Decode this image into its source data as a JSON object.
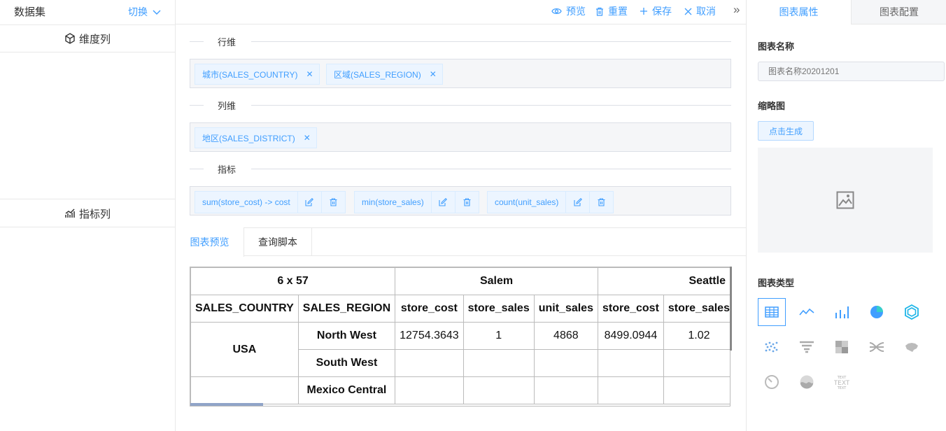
{
  "left": {
    "title": "数据集",
    "switch_label": "切换",
    "dimension_header": "维度列",
    "measure_header": "指标列"
  },
  "toolbar": {
    "preview": "预览",
    "reset": "重置",
    "save": "保存",
    "cancel": "取消"
  },
  "sections": {
    "row_dim": "行维",
    "col_dim": "列维",
    "measure": "指标"
  },
  "row_tags": [
    "城市(SALES_COUNTRY)",
    "区域(SALES_REGION)"
  ],
  "col_tags": [
    "地区(SALES_DISTRICT)"
  ],
  "measure_tags": [
    "sum(store_cost) -> cost",
    "min(store_sales)",
    "count(unit_sales)"
  ],
  "tabs": {
    "preview": "图表预览",
    "script": "查询脚本"
  },
  "table": {
    "corner": "6 x 57",
    "col_groups": [
      "Salem",
      "Seattle"
    ],
    "row_headers": [
      "SALES_COUNTRY",
      "SALES_REGION"
    ],
    "measure_headers": [
      "store_cost",
      "store_sales",
      "unit_sales",
      "store_cost",
      "store_sales"
    ],
    "country": "USA",
    "regions": [
      "North West",
      "South West",
      "Mexico Central"
    ],
    "row1_values": [
      "12754.3643",
      "1",
      "4868",
      "8499.0944",
      "1.02"
    ]
  },
  "right": {
    "tab_props": "图表属性",
    "tab_config": "图表配置",
    "name_label": "图表名称",
    "name_placeholder": "图表名称20201201",
    "thumb_label": "缩略图",
    "gen_button": "点击生成",
    "type_label": "图表类型",
    "chart_types": [
      "table",
      "line",
      "bar",
      "pie",
      "radar",
      "scatter",
      "funnel",
      "heatmap",
      "parallel",
      "map",
      "gauge",
      "liquid",
      "word-cloud"
    ]
  },
  "colors": {
    "accent": "#409eff",
    "tag_bg": "#ecf5ff"
  }
}
